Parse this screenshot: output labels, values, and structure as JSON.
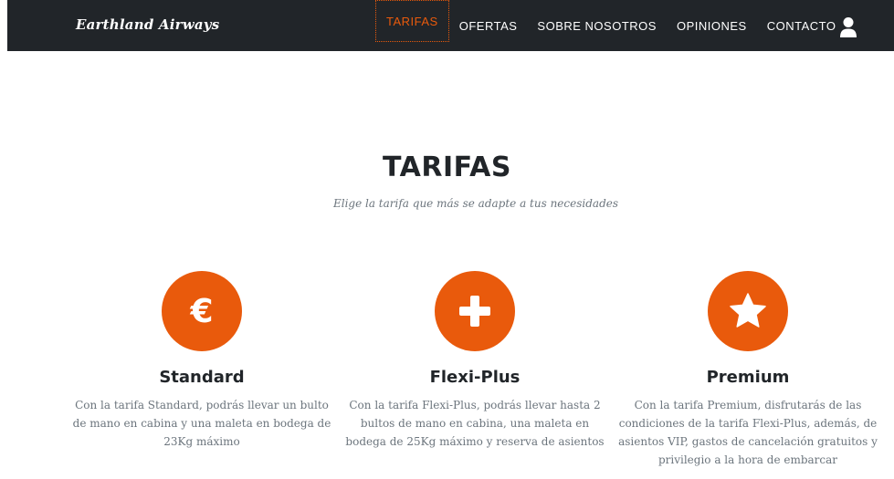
{
  "navbar": {
    "brand": "Earthland Airways",
    "items": [
      {
        "label": "TARIFAS",
        "active": true
      },
      {
        "label": "OFERTAS",
        "active": false
      },
      {
        "label": "SOBRE NOSOTROS",
        "active": false
      },
      {
        "label": "OPINIONES",
        "active": false
      },
      {
        "label": "CONTACTO",
        "active": false
      }
    ],
    "user_icon": "user-icon"
  },
  "section": {
    "title": "TARIFAS",
    "subtitle": "Elige la tarifa que más se adapte a tus necesidades"
  },
  "plans": [
    {
      "icon": "euro-icon",
      "name": "Standard",
      "description": "Con la tarifa Standard, podrás llevar un bulto de mano en cabina y una maleta en bodega de 23Kg máximo"
    },
    {
      "icon": "plus-icon",
      "name": "Flexi-Plus",
      "description": "Con la tarifa Flexi-Plus, podrás llevar hasta 2 bultos de mano en cabina, una maleta en bodega de 25Kg máximo y reserva de asientos"
    },
    {
      "icon": "star-icon",
      "name": "Premium",
      "description": "Con la tarifa Premium, disfrutarás de las condiciones de la tarifa Flexi-Plus, además, de asientos VIP, gastos de cancelación gratuitos y privilegio a la hora de embarcar"
    }
  ],
  "colors": {
    "navbar_bg": "#212529",
    "accent": "#e95a0c",
    "text_dark": "#212529",
    "text_muted": "#6c757d"
  }
}
